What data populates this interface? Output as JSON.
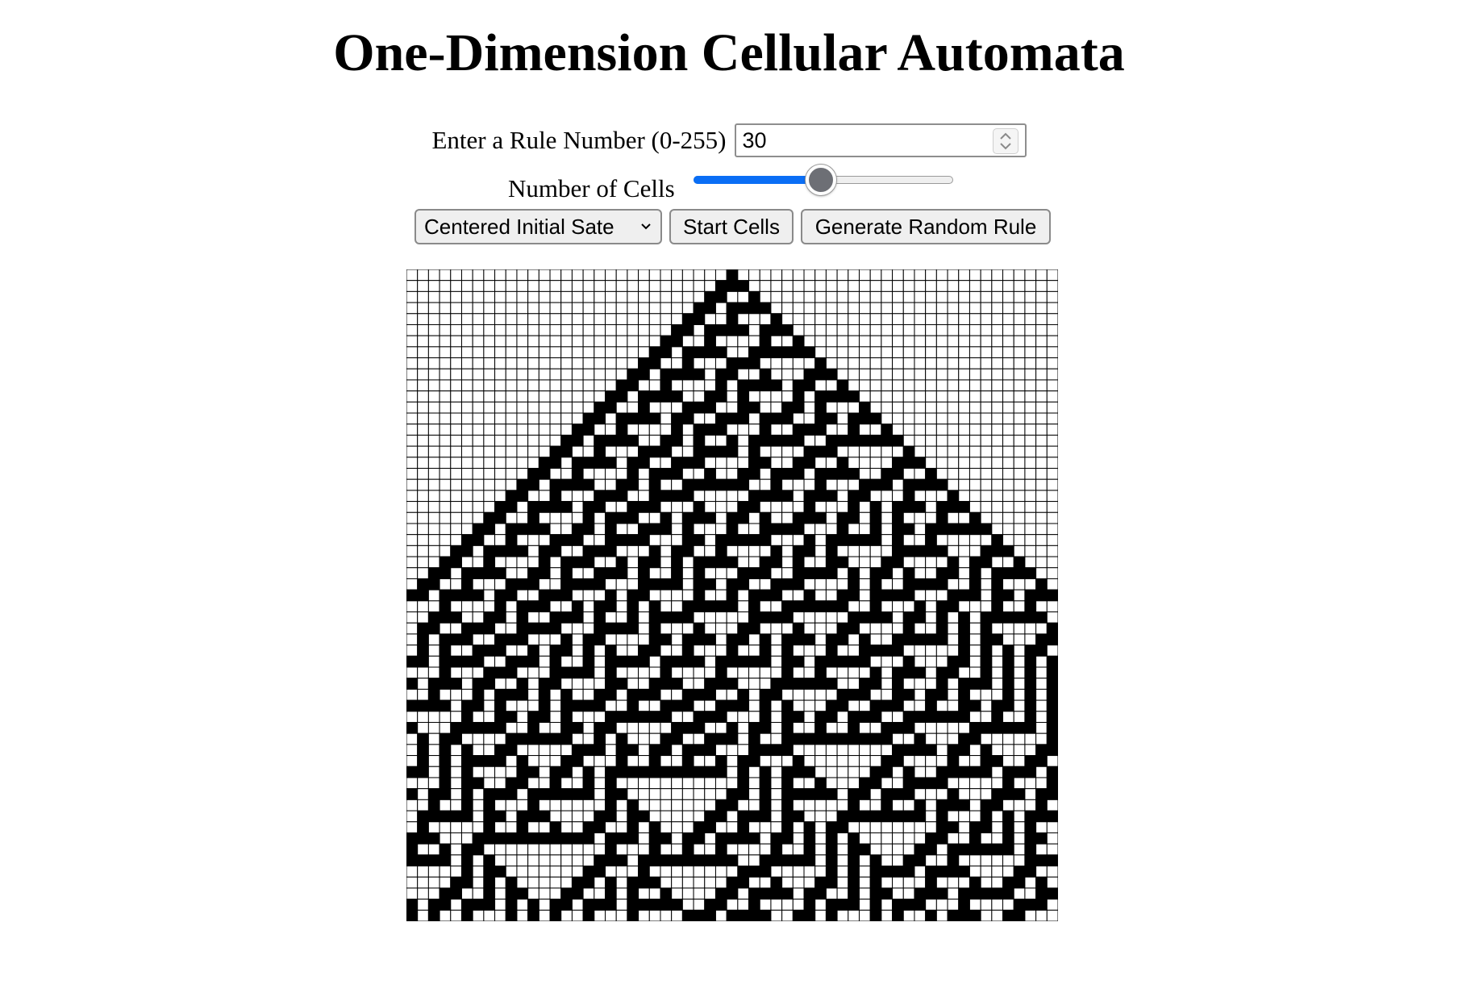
{
  "page": {
    "title": "One-Dimension Cellular Automata"
  },
  "controls": {
    "rule_label": "Enter a Rule Number (0-255)",
    "rule_value": "30",
    "cells_label": "Number of Cells",
    "cells_slider_fraction": 0.49,
    "initial_state_selected": "Centered Initial Sate",
    "start_button": "Start Cells",
    "random_button": "Generate Random Rule",
    "slider_accent": "#0a6ef5"
  },
  "automaton": {
    "rule": 30,
    "columns": 59,
    "rows": 59,
    "initial_state": "centered",
    "boundary": "wrap",
    "alive_color": "#000000",
    "dead_color": "#ffffff",
    "grid_line_color": "#000000"
  },
  "icons": {
    "spinner": "up-down-chevron-icon",
    "select_chevron": "chevron-down-icon"
  }
}
